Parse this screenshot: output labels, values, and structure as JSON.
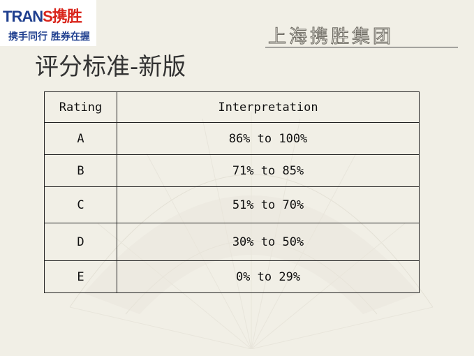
{
  "logo": {
    "brand_blue": "TRAN",
    "brand_red": "S",
    "brand_cn": "携胜",
    "tagline": "携手同行 胜券在握"
  },
  "header": {
    "company": "上海携胜集团",
    "title": "评分标准-新版"
  },
  "table": {
    "headers": [
      "Rating",
      "Interpretation"
    ],
    "rows": [
      {
        "rating": "A",
        "interpretation": "86% to 100%"
      },
      {
        "rating": "B",
        "interpretation": "71% to 85%"
      },
      {
        "rating": "C",
        "interpretation": "51% to 70%"
      },
      {
        "rating": "D",
        "interpretation": "30% to 50%"
      },
      {
        "rating": "E",
        "interpretation": "0% to 29%"
      }
    ]
  },
  "colors": {
    "background": "#f1efe6",
    "logo_blue": "#1f3f8f",
    "logo_red": "#d9241b"
  }
}
